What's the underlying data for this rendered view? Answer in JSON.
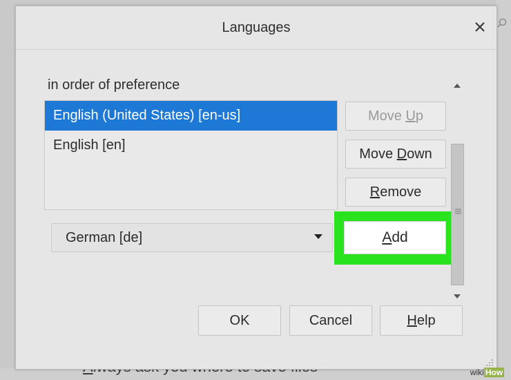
{
  "background": {
    "footer_text_underlined": "A",
    "footer_text_rest": "lways ask you where to save files"
  },
  "dialog": {
    "title": "Languages",
    "subtitle": "in order of preference",
    "languages": [
      {
        "label": "English (United States) [en-us]",
        "selected": true
      },
      {
        "label": "English [en]",
        "selected": false
      }
    ],
    "buttons": {
      "move_up": {
        "pre": "Move ",
        "key": "U",
        "post": "p",
        "enabled": false
      },
      "move_down": {
        "pre": "Move ",
        "key": "D",
        "post": "own",
        "enabled": true
      },
      "remove": {
        "pre": "",
        "key": "R",
        "post": "emove",
        "enabled": true
      },
      "add": {
        "pre": "",
        "key": "A",
        "post": "dd"
      },
      "ok": "OK",
      "cancel": "Cancel",
      "help": {
        "pre": "",
        "key": "H",
        "post": "elp"
      }
    },
    "language_select": {
      "value": "German [de]"
    },
    "highlight_color": "#29e31f",
    "selection_color": "#1e78d6"
  },
  "watermark": {
    "part1": "wiki",
    "part2": "How"
  }
}
